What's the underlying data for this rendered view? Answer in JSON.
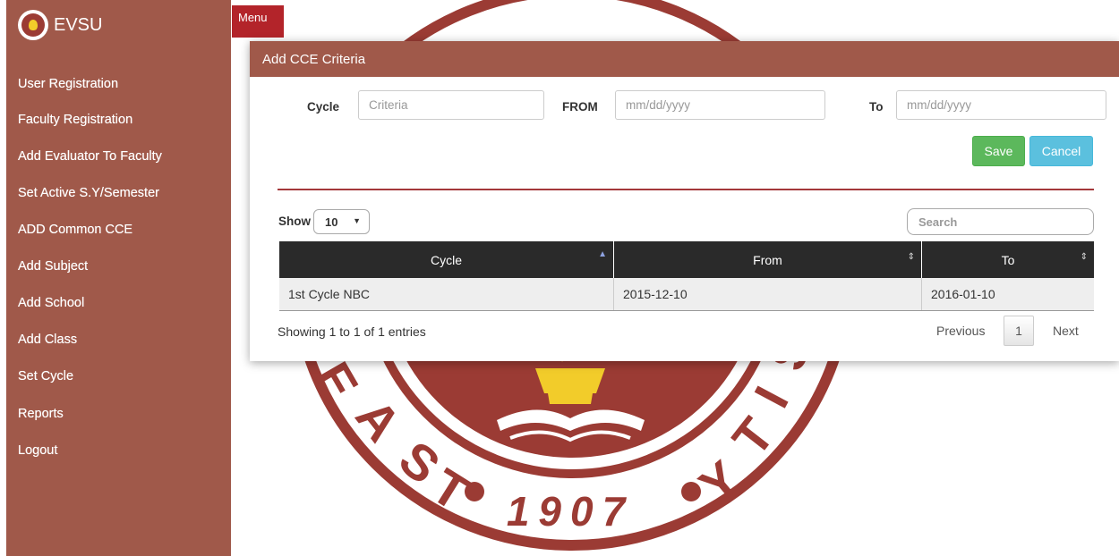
{
  "brand": {
    "name": "EVSU"
  },
  "sidebar": {
    "items": [
      {
        "label": "User Registration"
      },
      {
        "label": "Faculty Registration"
      },
      {
        "label": "Add Evaluator To Faculty"
      },
      {
        "label": "Set Active S.Y/Semester"
      },
      {
        "label": "ADD Common CCE"
      },
      {
        "label": "Add Subject"
      },
      {
        "label": "Add School"
      },
      {
        "label": "Add Class"
      },
      {
        "label": "Set Cycle"
      },
      {
        "label": "Reports"
      },
      {
        "label": "Logout"
      }
    ]
  },
  "menu_button": {
    "label": "Menu"
  },
  "emblem": {
    "year": "1907",
    "letters_left": "EAST",
    "letters_right": "SITY"
  },
  "modal": {
    "title": "Add CCE Criteria",
    "form": {
      "cycle_label": "Cycle",
      "cycle_placeholder": "Criteria",
      "from_label": "FROM",
      "from_placeholder": "mm/dd/yyyy",
      "to_label": "To",
      "to_placeholder": "mm/dd/yyyy"
    },
    "buttons": {
      "save": "Save",
      "cancel": "Cancel"
    },
    "table_controls": {
      "show_label": "Show",
      "show_value": "10",
      "search_placeholder": "Search"
    },
    "table": {
      "columns": [
        "Cycle",
        "From",
        "To"
      ],
      "rows": [
        [
          "1st Cycle NBC",
          "2015-12-10",
          "2016-01-10"
        ]
      ]
    },
    "info": "Showing 1 to 1 of 1 entries",
    "pagination": {
      "previous": "Previous",
      "current_page": "1",
      "next": "Next"
    }
  },
  "colors": {
    "sidebar": "#a0594a",
    "menu_button": "#b3242a",
    "emblem": "#9b3b34",
    "save": "#5cb85c",
    "cancel": "#5bc0de",
    "table_header": "#2a2a2a"
  }
}
